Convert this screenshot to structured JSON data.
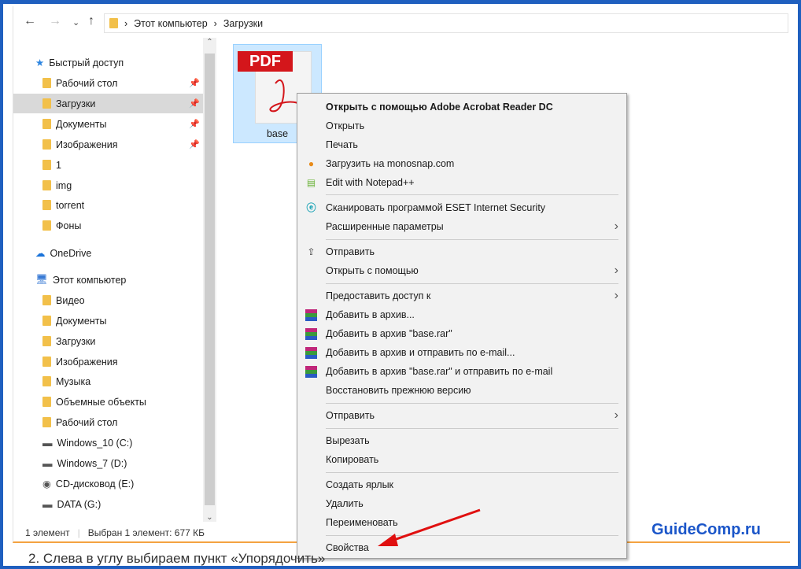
{
  "address": {
    "path": [
      "Этот компьютер",
      "Загрузки"
    ]
  },
  "nav": {
    "quick_access": "Быстрый доступ",
    "quick_items": [
      "Рабочий стол",
      "Загрузки",
      "Документы",
      "Изображения",
      "1",
      "img",
      "torrent",
      "Фоны"
    ],
    "onedrive": "OneDrive",
    "this_pc": "Этот компьютер",
    "pc_items": [
      "Видео",
      "Документы",
      "Загрузки",
      "Изображения",
      "Музыка",
      "Объемные объекты",
      "Рабочий стол",
      "Windows_10 (C:)",
      "Windows_7 (D:)",
      "CD-дисковод (E:)",
      "DATA (G:)"
    ]
  },
  "file": {
    "badge": "PDF",
    "name": "base"
  },
  "status": {
    "count": "1 элемент",
    "selected": "Выбран 1 элемент: 677 КБ"
  },
  "menu": [
    "Открыть с помощью Adobe Acrobat Reader DC",
    "Открыть",
    "Печать",
    "Загрузить на monosnap.com",
    "Edit with Notepad++",
    "Сканировать программой ESET Internet Security",
    "Расширенные параметры",
    "Отправить",
    "Открыть с помощью",
    "Предоставить доступ к",
    "Добавить в архив...",
    "Добавить в архив \"base.rar\"",
    "Добавить в архив и отправить по e-mail...",
    "Добавить в архив \"base.rar\" и отправить по e-mail",
    "Восстановить прежнюю версию",
    "Отправить",
    "Вырезать",
    "Копировать",
    "Создать ярлык",
    "Удалить",
    "Переименовать",
    "Свойства"
  ],
  "watermark": "GuideComp.ru",
  "caption": "2. Слева в углу выбираем пункт «Упорядочить»"
}
